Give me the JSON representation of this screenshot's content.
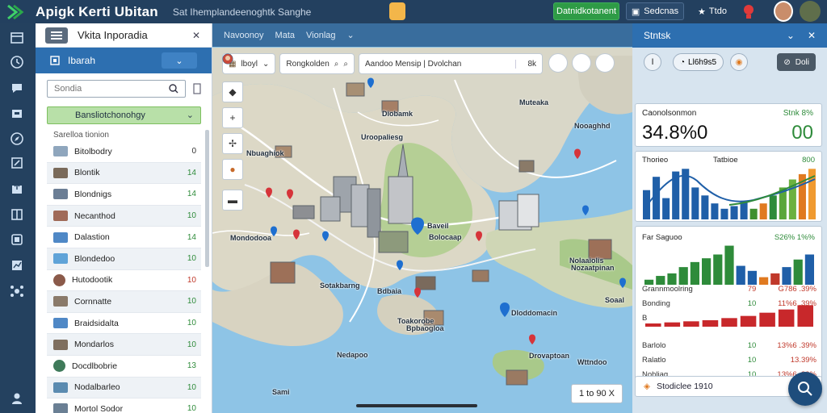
{
  "header": {
    "app_title": "Apigk Kerti Ubitan",
    "subtitle": "Sat Ihemplandeenoghtk Sanghe",
    "primary_button": "Datnidkotanent",
    "toolbar_button_1": "Sedcnas",
    "toolbar_button_2": "Ttdo",
    "accent_color": "#2e9b46",
    "brand_color": "#23405f",
    "icons": [
      "logo-icon",
      "alert-icon",
      "avatar",
      "avatar"
    ]
  },
  "sidebar": {
    "icons": [
      "grid-icon",
      "clock-icon",
      "chat-icon",
      "inbox-icon",
      "compass-icon",
      "edit-icon",
      "upload-icon",
      "book-icon",
      "layers-icon",
      "chart-icon",
      "network-icon",
      "user-icon"
    ]
  },
  "list_panel": {
    "title": "Vkita Inporadia",
    "dataset_label": "Ibarah",
    "search_placeholder": "Sondia",
    "group_header": "Bansliotchonohgy",
    "subgroup_label": "Sarelloa tionion",
    "items": [
      {
        "label": "Bitolbodry",
        "count": "0",
        "thumb": "#8fa6bd",
        "count_color": "#333333"
      },
      {
        "label": "Blontik",
        "count": "14",
        "thumb": "#7a6a5a",
        "count_color": "#2e8b3a"
      },
      {
        "label": "Blondnigs",
        "count": "14",
        "thumb": "#6b7e95",
        "count_color": "#2e8b3a"
      },
      {
        "label": "Necanthod",
        "count": "10",
        "thumb": "#a06a58",
        "count_color": "#2e8b3a"
      },
      {
        "label": "Dalastion",
        "count": "14",
        "thumb": "#4f88c6",
        "count_color": "#2e8b3a"
      },
      {
        "label": "Blondedoo",
        "count": "10",
        "thumb": "#5fa3d8",
        "count_color": "#2e8b3a"
      },
      {
        "label": "Hutodootik",
        "count": "10",
        "thumb": "#8b5a4a",
        "count_color": "#c0392b"
      },
      {
        "label": "Cornnatte",
        "count": "10",
        "thumb": "#8a7a6a",
        "count_color": "#2e8b3a"
      },
      {
        "label": "Braidsidalta",
        "count": "10",
        "thumb": "#4f88c6",
        "count_color": "#2e8b3a"
      },
      {
        "label": "Mondarlos",
        "count": "10",
        "thumb": "#7f6f5f",
        "count_color": "#2e8b3a"
      },
      {
        "label": "Docdlbobrie",
        "count": "13",
        "thumb": "#3f7a5a",
        "count_color": "#2e8b3a"
      },
      {
        "label": "Nodalbarleo",
        "count": "10",
        "thumb": "#5b8bb0",
        "count_color": "#2e8b3a"
      },
      {
        "label": "Mortol Sodor",
        "count": "10",
        "thumb": "#6a7f94",
        "count_color": "#2e8b3a"
      }
    ]
  },
  "map": {
    "tabs": [
      "Navoonoy",
      "Mata",
      "Vionlag"
    ],
    "chips": [
      "lboyl",
      "Rongkolden",
      "Aandoo Mensip | Dvolchan",
      "8k"
    ],
    "labels": [
      "Diobamk",
      "Muteaka",
      "Uroopaliesg",
      "Nbuaghiok",
      "Nooaghhd",
      "Baveil",
      "Bolocaap",
      "Mondodooa",
      "Nolaaiolis",
      "Sotakbarng",
      "Bdbaia",
      "Toakorobe",
      "Dloddomacin",
      "Nozaatpinan",
      "Bpbaogloa",
      "Nedapoo",
      "Drovaptoan",
      "Sami",
      "Wttndoo",
      "Soaal"
    ],
    "scale": "1 to 90 X"
  },
  "right_panel": {
    "title": "Stntsk",
    "toolbar_pill": "Ll6h9s5",
    "toolbar_dark": "Doli",
    "kpi": {
      "label_left": "Caonolsonmon",
      "label_right": "Stnk 8%",
      "value_left": "34.8%0",
      "value_right": "00"
    },
    "trend": {
      "label_left": "Thorieo",
      "label_mid": "Tatbioe",
      "label_right": "800"
    },
    "compare": {
      "title": "Far Saguoo",
      "headline": "S26% 1%%",
      "rows": [
        {
          "name": "Grannmoolring",
          "mid": "79",
          "right": "G786 .39%",
          "mid_color": "#c0392b"
        },
        {
          "name": "Bonding",
          "mid": "10",
          "right": "11%6 .39%",
          "mid_color": "#2e8b3a"
        },
        {
          "name": "B",
          "mid": "",
          "right": "",
          "mid_color": "#2e8b3a"
        },
        {
          "name": "Barlolo",
          "mid": "10",
          "right": "13%6 .39%",
          "mid_color": "#2e8b3a"
        },
        {
          "name": "Ralatlo",
          "mid": "10",
          "right": "13.39%",
          "mid_color": "#2e8b3a"
        },
        {
          "name": "Nohliag",
          "mid": "10",
          "right": "13%6 .39%",
          "mid_color": "#2e8b3a"
        }
      ]
    },
    "footer": "Stodiclee 1910"
  },
  "chart_data": [
    {
      "type": "bar",
      "title": "",
      "series": [
        {
          "values": [
            55,
            80,
            40,
            90,
            95,
            60,
            45,
            30,
            20,
            25,
            35,
            20,
            30,
            45,
            60,
            75,
            85,
            95
          ]
        }
      ]
    },
    {
      "type": "bar",
      "title": "Far Saguoo",
      "series": [
        {
          "values": [
            8,
            14,
            18,
            28,
            36,
            42,
            48,
            62,
            30,
            22,
            12,
            18,
            28,
            40,
            48
          ]
        }
      ]
    },
    {
      "type": "bar",
      "series": [
        {
          "values": [
            6,
            8,
            10,
            12,
            16,
            20,
            26,
            32,
            40
          ]
        }
      ]
    }
  ]
}
